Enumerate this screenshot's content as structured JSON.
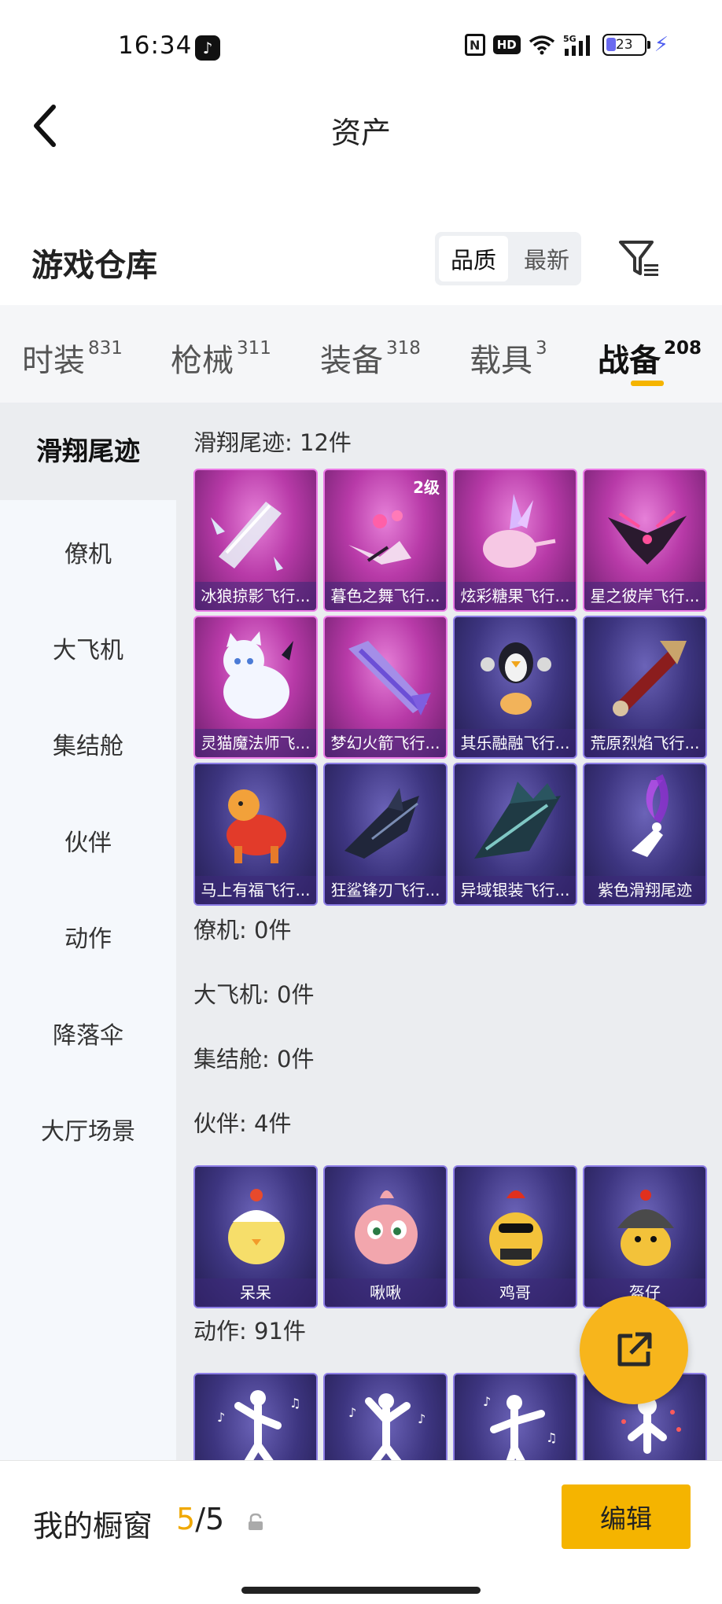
{
  "status": {
    "time": "16:34",
    "battery": "23",
    "network": "5G"
  },
  "header": {
    "title": "资产",
    "section_title": "游戏仓库",
    "sort_options": [
      "品质",
      "最新"
    ],
    "sort_active": "品质"
  },
  "tabs": [
    {
      "label": "时装",
      "count": "831"
    },
    {
      "label": "枪械",
      "count": "311"
    },
    {
      "label": "装备",
      "count": "318"
    },
    {
      "label": "载具",
      "count": "3"
    },
    {
      "label": "战备",
      "count": "208"
    }
  ],
  "active_tab": "战备",
  "sidebar": {
    "items": [
      "滑翔尾迹",
      "僚机",
      "大飞机",
      "集结舱",
      "伙伴",
      "动作",
      "降落伞",
      "大厅场景"
    ],
    "active": "滑翔尾迹"
  },
  "groups": {
    "trail": {
      "title": "滑翔尾迹: 12件",
      "items": [
        {
          "name": "冰狼掠影飞行...",
          "rarity": "pink",
          "badge": ""
        },
        {
          "name": "暮色之舞飞行...",
          "rarity": "pink",
          "badge": "2级"
        },
        {
          "name": "炫彩糖果飞行...",
          "rarity": "pink",
          "badge": ""
        },
        {
          "name": "星之彼岸飞行...",
          "rarity": "pink",
          "badge": ""
        },
        {
          "name": "灵猫魔法师飞...",
          "rarity": "pink",
          "badge": ""
        },
        {
          "name": "梦幻火箭飞行...",
          "rarity": "pink",
          "badge": ""
        },
        {
          "name": "其乐融融飞行...",
          "rarity": "purple",
          "badge": ""
        },
        {
          "name": "荒原烈焰飞行...",
          "rarity": "purple",
          "badge": ""
        },
        {
          "name": "马上有福飞行...",
          "rarity": "purple",
          "badge": ""
        },
        {
          "name": "狂鲨锋刃飞行...",
          "rarity": "purple",
          "badge": ""
        },
        {
          "name": "异域银装飞行...",
          "rarity": "purple",
          "badge": ""
        },
        {
          "name": "紫色滑翔尾迹",
          "rarity": "purple",
          "badge": ""
        }
      ]
    },
    "wingman_title": "僚机: 0件",
    "plane_title": "大飞机: 0件",
    "pod_title": "集结舱: 0件",
    "partner": {
      "title": "伙伴: 4件",
      "items": [
        {
          "name": "呆呆",
          "rarity": "purple"
        },
        {
          "name": "啾啾",
          "rarity": "purple"
        },
        {
          "name": "鸡哥",
          "rarity": "purple"
        },
        {
          "name": "盔仔",
          "rarity": "purple"
        }
      ]
    },
    "emote": {
      "title": "动作: 91件"
    }
  },
  "showcase": {
    "label": "我的橱窗",
    "current": "5",
    "total": "/5",
    "edit_label": "编辑"
  },
  "colors": {
    "accent": "#f5b400",
    "pink_rarity": "#b83aa8",
    "purple_rarity": "#3d3580"
  }
}
